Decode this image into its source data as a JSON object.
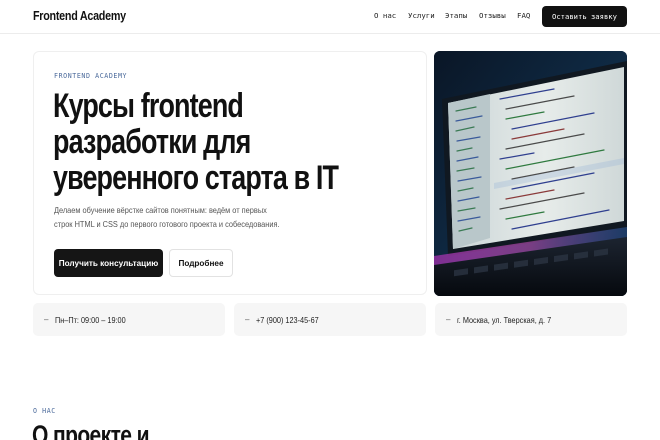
{
  "header": {
    "logo": "Frontend Academy",
    "nav": [
      "О нас",
      "Услуги",
      "Этапы",
      "Отзывы",
      "FAQ"
    ],
    "cta": "Оставить заявку"
  },
  "hero": {
    "eyebrow": "FRONTEND ACADEMY",
    "title_lines": [
      "Курсы frontend",
      "разработки для",
      "уверенного старта в IT"
    ],
    "description_lines": [
      "Делаем обучение вёрстке сайтов понятным: ведём от первых",
      "строк HTML и CSS до первого готового проекта и собеседования."
    ],
    "primary_button": "Получить консультацию",
    "secondary_button": "Подробнее"
  },
  "info": [
    {
      "icon": "dash",
      "text": "Пн–Пт: 09:00 – 19:00"
    },
    {
      "icon": "dash",
      "text": "+7 (900) 123-45-67"
    },
    {
      "icon": "dash",
      "text": "г. Москва, ул. Тверская, д. 7"
    }
  ],
  "about": {
    "eyebrow": "О НАС",
    "title": "О проекте и"
  }
}
